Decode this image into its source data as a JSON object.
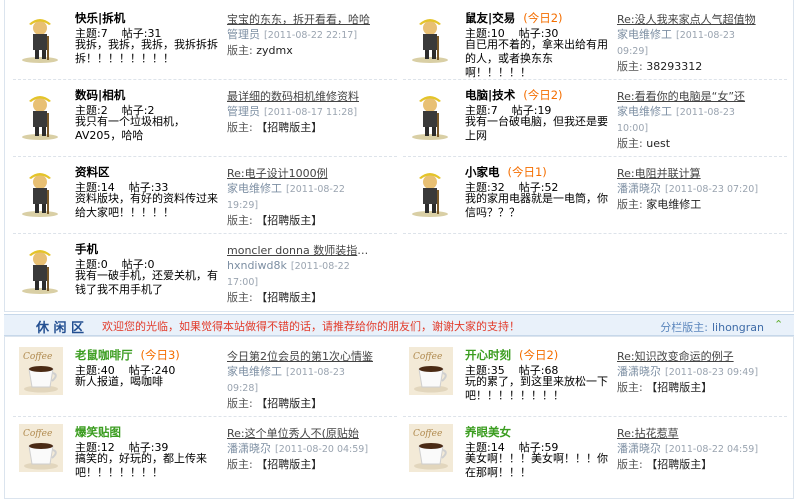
{
  "labels": {
    "topics": "主题:",
    "posts": "帖子:",
    "moderator": "版主:"
  },
  "top_forums": [
    {
      "title": "快乐|拆机",
      "today": "",
      "topics": "7",
      "posts": "31",
      "desc": "我拆，我拆，我拆，我拆拆拆拆！！！！！！！！",
      "last_title": "宝宝的东东，拆开看看，哈哈",
      "last_user": "管理员",
      "last_date": "2011-08-22 22:17",
      "moderator": "zydmx"
    },
    {
      "title": "鼠友|交易",
      "today": "(今日2)",
      "topics": "10",
      "posts": "30",
      "desc": "自已用不着的，拿来出给有用的人，或者换东东啊！！！！！",
      "last_title": "Re:没人我来家点人气超值物",
      "last_user": "家电维修工",
      "last_date": "2011-08-23 09:29",
      "moderator": "38293312"
    },
    {
      "title": "数码|相机",
      "today": "",
      "topics": "2",
      "posts": "2",
      "desc": "我只有一个垃圾相机，AV205，哈哈",
      "last_title": "最详细的数码相机维修资料",
      "last_user": "管理员",
      "last_date": "2011-08-17 11:28",
      "moderator": "【招聘版主】"
    },
    {
      "title": "电脑|技术",
      "today": "(今日2)",
      "topics": "7",
      "posts": "19",
      "desc": "我有一台破电脑，但我还是要上网",
      "last_title": "Re:看看你的电脑是“女”还",
      "last_user": "家电维修工",
      "last_date": "2011-08-23 10:00",
      "moderator": "uest"
    },
    {
      "title": "资料区",
      "today": "",
      "topics": "14",
      "posts": "33",
      "desc": "资料版块，有好的资料传过来给大家吧！！！！！",
      "last_title": "Re:电子设计1000例",
      "last_user": "家电维修工",
      "last_date": "2011-08-22 19:29",
      "moderator": "【招聘版主】"
    },
    {
      "title": "小家电",
      "today": "(今日1)",
      "topics": "32",
      "posts": "52",
      "desc": "我的家用电器就是一电筒，你信吗？？？",
      "last_title": "Re:电阻并联计算",
      "last_user": "潘潇晓尕",
      "last_date": "2011-08-23 07:20",
      "moderator": "家电维修工"
    },
    {
      "title": "手机",
      "today": "",
      "topics": "0",
      "posts": "0",
      "desc": "我有一破手机，还爱关机，有钱了我不用手机了",
      "last_title": "moncler donna 数师装指驶打",
      "last_user": "hxndiwd8k",
      "last_date": "2011-08-22 17:00",
      "moderator": "【招聘版主】"
    }
  ],
  "category": {
    "title": "休 闲 区",
    "notice": "欢迎您的光临，如果觉得本站做得不错的话，请推荐给你的朋友们，谢谢大家的支持！",
    "moderator_label": "分栏版主:",
    "moderator": "lihongran"
  },
  "bottom_forums": [
    {
      "title": "老鼠咖啡厅",
      "today": "(今日3)",
      "topics": "40",
      "posts": "240",
      "desc": "新人报道，喝咖啡",
      "last_title": "今日第2位会员的第1次心情鉴",
      "last_user": "家电维修工",
      "last_date": "2011-08-23 09:28",
      "moderator": "【招聘版主】"
    },
    {
      "title": "开心时刻",
      "today": "(今日2)",
      "topics": "35",
      "posts": "68",
      "desc": "玩的累了，到这里来放松一下吧！！！！！！！！",
      "last_title": "Re:知识改变命运的例子",
      "last_user": "潘潇晓尕",
      "last_date": "2011-08-23 09:49",
      "moderator": "【招聘版主】"
    },
    {
      "title": "爆笑贴图",
      "today": "",
      "topics": "12",
      "posts": "39",
      "desc": "搞笑的，好玩的，都上传来吧！！！！！！！",
      "last_title": "Re:这个单位秀人不(原贴始",
      "last_user": "潘潇晓尕",
      "last_date": "2011-08-20 04:59",
      "moderator": "【招聘版主】"
    },
    {
      "title": "养眼美女",
      "today": "",
      "topics": "14",
      "posts": "59",
      "desc": "美女啊！！！美女啊！！！你在那啊！！！",
      "last_title": "Re:拈花惹草",
      "last_user": "潘潇晓尕",
      "last_date": "2011-08-22 04:59",
      "moderator": "【招聘版主】"
    }
  ]
}
